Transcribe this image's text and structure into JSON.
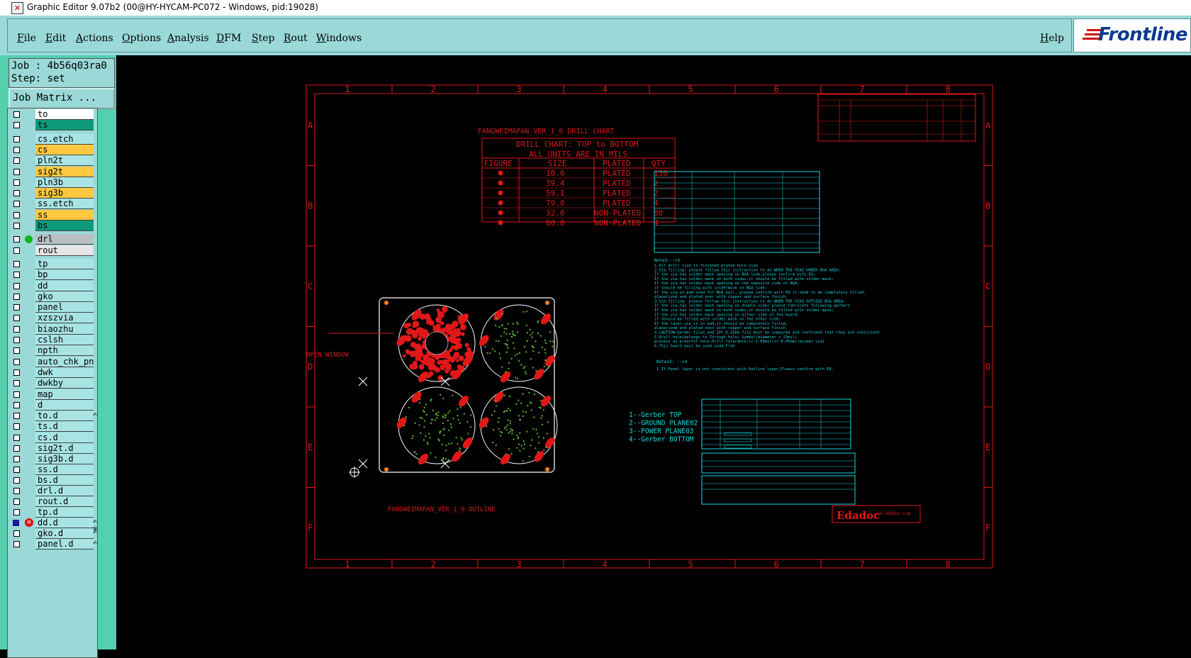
{
  "window": {
    "title": "Graphic Editor 9.07b2 (00@HY-HYCAM-PC072 - Windows, pid:19028)"
  },
  "menu": {
    "items": [
      "File",
      "Edit",
      "Actions",
      "Options",
      "Analysis",
      "DFM",
      "Step",
      "Rout",
      "Windows"
    ],
    "help": "Help",
    "logo": "Frontline"
  },
  "panel": {
    "job": "Job : 4b56q03ra0",
    "step": "Step: set",
    "job_matrix": "Job Matrix ..."
  },
  "layers": [
    {
      "name": "to",
      "color": "white"
    },
    {
      "name": "ts",
      "color": "green"
    },
    {
      "name": "cs.etch",
      "color": "default"
    },
    {
      "name": "cs",
      "color": "orange"
    },
    {
      "name": "pln2t",
      "color": "default"
    },
    {
      "name": "sig2t",
      "color": "orange"
    },
    {
      "name": "pln3b",
      "color": "default"
    },
    {
      "name": "sig3b",
      "color": "orange"
    },
    {
      "name": "ss.etch",
      "color": "default"
    },
    {
      "name": "ss",
      "color": "orange"
    },
    {
      "name": "bs",
      "color": "green"
    },
    {
      "name": "drl",
      "color": "gray",
      "active": true
    },
    {
      "name": "rout",
      "color": "light"
    },
    {
      "name": "tp",
      "color": "default"
    },
    {
      "name": "bp",
      "color": "default"
    },
    {
      "name": "dd",
      "color": "default"
    },
    {
      "name": "gko",
      "color": "default"
    },
    {
      "name": "panel",
      "color": "default"
    },
    {
      "name": "xzszvia",
      "color": "default"
    },
    {
      "name": "biaozhu",
      "color": "default"
    },
    {
      "name": "cslsh",
      "color": "default"
    },
    {
      "name": "npth",
      "color": "default"
    },
    {
      "name": "auto_chk_pn",
      "color": "default"
    },
    {
      "name": "dwk",
      "color": "default"
    },
    {
      "name": "dwkby",
      "color": "default"
    },
    {
      "name": "map",
      "color": "default"
    },
    {
      "name": "d",
      "color": "default"
    },
    {
      "name": "to.d",
      "color": "default",
      "extra": "✍"
    },
    {
      "name": "ts.d",
      "color": "default"
    },
    {
      "name": "cs.d",
      "color": "default"
    },
    {
      "name": "sig2t.d",
      "color": "default"
    },
    {
      "name": "sig3b.d",
      "color": "default"
    },
    {
      "name": "ss.d",
      "color": "default"
    },
    {
      "name": "bs.d",
      "color": "default"
    },
    {
      "name": "drl.d",
      "color": "default"
    },
    {
      "name": "rout.d",
      "color": "default"
    },
    {
      "name": "tp.d",
      "color": "default"
    },
    {
      "name": "dd.d",
      "color": "default",
      "special": true,
      "extra": "✍≡"
    },
    {
      "name": "gko.d",
      "color": "default",
      "extra": "✍"
    },
    {
      "name": "panel.d",
      "color": "default",
      "extra": "✍"
    }
  ],
  "drawing": {
    "grid_cols": [
      "1",
      "2",
      "3",
      "4",
      "5",
      "6",
      "7",
      "8"
    ],
    "grid_rows": [
      "A",
      "B",
      "C",
      "D",
      "E",
      "F"
    ],
    "drill_chart_title": "FANGWEIMAPAN_VER_1_0 DRILL CHART",
    "drill_header1": "DRILL CHART: TOP to BOTTOM",
    "drill_header2": "ALL UNITS ARE IN MILS",
    "drill_columns": [
      "FIGURE",
      "SIZE",
      "PLATED",
      "QTY"
    ],
    "drill_rows": [
      {
        "size": "10.0",
        "plated": "PLATED",
        "qty": "130"
      },
      {
        "size": "39.4",
        "plated": "PLATED",
        "qty": "2"
      },
      {
        "size": "59.1",
        "plated": "PLATED",
        "qty": "2"
      },
      {
        "size": "79.0",
        "plated": "PLATED",
        "qty": "4"
      },
      {
        "size": "32.0",
        "plated": "NON-PLATED",
        "qty": "80"
      },
      {
        "size": "80.0",
        "plated": "NON-PLATED",
        "qty": "4"
      }
    ],
    "open_window": "OPEN WINDOW",
    "outline_label": "FANGWEIMAPAN_VER_1_0 OUTLINE",
    "layer_legend": [
      "1--Gerber TOP",
      "2--GROUND PLANE02",
      "3--POWER PLANE03",
      "4--Gerber BOTTOM"
    ],
    "notes_header": "Note2:-->3",
    "notes": [
      "1.All drill size is finished plated hole size",
      "2.Via filling: please follow this instruction to do WHEN THE VIAS UNDER BGA AREA:",
      "   If the via has solder mask opening on BGA side,please confirm with EQ;",
      "   If the via has solder mask on both sides,it should be filled with solder mask;",
      "   If the via has solder mask opening on the opposite side of BGA,",
      "     it should be filling with soldermask on BGA side;",
      "   If the via-in-pad used for BGA ball, please confirm with EQ if need to be completely filled,",
      "     planarized and plated over with copper and surface finish.",
      "3.Via filling: please follow this instruction to do WHEN THE VIAS OUTSIDE BGA AREA:",
      "   If the via has solder mask opening on double sides please fabricate following gerbers",
      "   If the via has solder mask on both sides,it should be filled with solder mask;",
      "   If the via has solder mask opening on either side of the board,",
      "     it should be filled with solder mask on the other side;",
      "   If the laser via is in pad,it should be completely filled,",
      "     planarized and plated over with copper and surface finish.",
      "4.CAUTION:Gerber files and IPC-D-356A file must be compared and confirmed that they are consistent",
      "5.Drill hole(belongs to Through hole) Symbol(diameter < 23mil)",
      "  process as pressfit hole,Drill tolerance:+/-2.00mil(+/-0.05mm)(except via)",
      "6.This board must be used Lead-Free"
    ],
    "notes2_header": "Notes3: -->4",
    "notes2": [
      "1.If Panel layer is not consistent with Outline layer,Please confirm with EQ."
    ],
    "title_block_brand": "Edadoc",
    "title_block_sub": "www.edadoc.com"
  }
}
